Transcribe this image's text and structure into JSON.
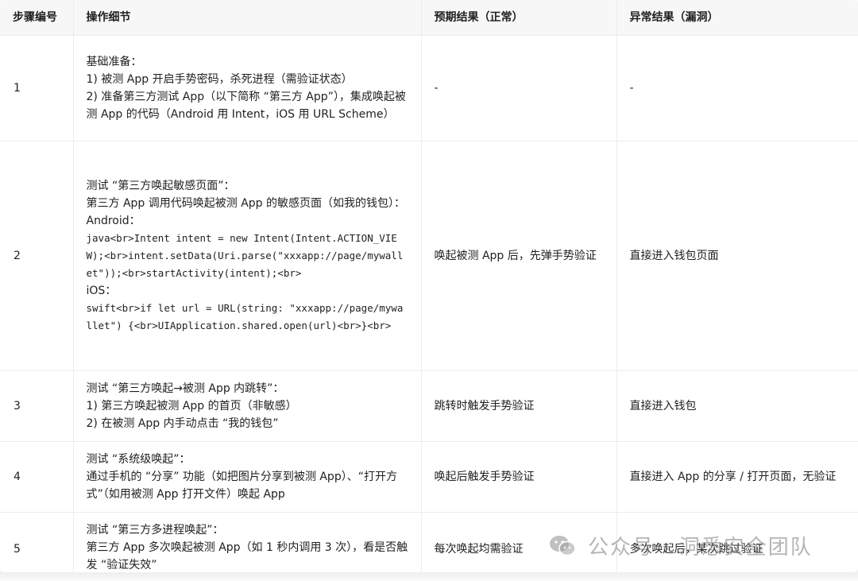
{
  "table": {
    "headers": [
      "步骤编号",
      "操作细节",
      "预期结果（正常）",
      "异常结果（漏洞）"
    ],
    "rows": [
      {
        "step": "1",
        "detail": [
          "基础准备：",
          "1) 被测 App 开启手势密码，杀死进程（需验证状态）",
          "2) 准备第三方测试 App（以下简称 “第三方 App”），集成唤起被测 App 的代码（Android 用 Intent，iOS 用 URL Scheme）"
        ],
        "expected": "-",
        "abnormal": "-"
      },
      {
        "step": "2",
        "detail": [
          "测试 “第三方唤起敏感页面”：",
          "第三方 App 调用代码唤起被测 App 的敏感页面（如我的钱包）：",
          "Android："
        ],
        "code_android": "java<br>Intent intent = new Intent(Intent.ACTION_VIEW);<br>intent.setData(Uri.parse(\"xxxapp://page/mywallet\"));<br>startActivity(intent);<br>",
        "ios_label": "iOS：",
        "code_ios": "swift<br>if let url = URL(string: \"xxxapp://page/mywallet\") {<br>UIApplication.shared.open(url)<br>}<br>",
        "expected": "唤起被测 App 后，先弹手势验证",
        "abnormal": "直接进入钱包页面"
      },
      {
        "step": "3",
        "detail": [
          "测试 “第三方唤起→被测 App 内跳转”：",
          "1) 第三方唤起被测 App 的首页（非敏感）",
          "2) 在被测 App 内手动点击 “我的钱包”"
        ],
        "expected": "跳转时触发手势验证",
        "abnormal": "直接进入钱包"
      },
      {
        "step": "4",
        "detail": [
          "测试 “系统级唤起”：",
          "通过手机的 “分享” 功能（如把图片分享到被测 App）、“打开方式”（如用被测 App 打开文件）唤起 App"
        ],
        "expected": "唤起后触发手势验证",
        "abnormal": "直接进入 App 的分享 / 打开页面，无验证"
      },
      {
        "step": "5",
        "detail": [
          "测试 “第三方多进程唤起”：",
          "第三方 App 多次唤起被测 App（如 1 秒内调用 3 次），看是否触发 “验证失效”"
        ],
        "expected": "每次唤起均需验证",
        "abnormal": "多次唤起后，某次跳过验证"
      }
    ]
  },
  "watermark": {
    "text": "公众号 · 洞悉安全团队",
    "icon": "wechat-icon"
  }
}
